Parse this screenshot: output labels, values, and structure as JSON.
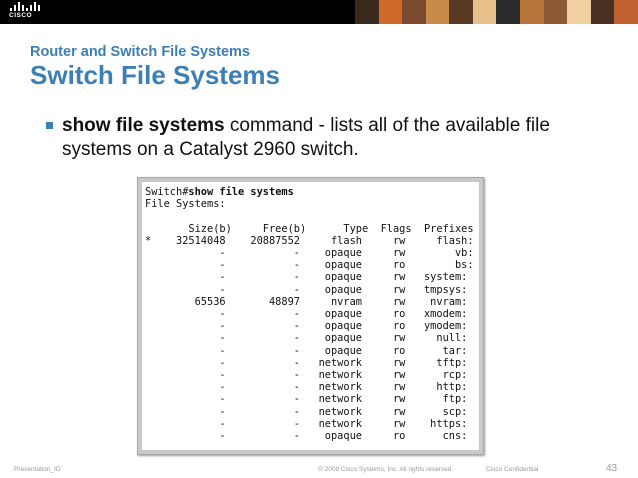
{
  "banner": {
    "logo_text": "CISCO",
    "photo_colors": [
      "#3a2a1c",
      "#d06a2a",
      "#7a4b2e",
      "#c98b4a",
      "#5a3a22",
      "#e8c08c",
      "#2a2a2a",
      "#b8763c",
      "#8c5a34",
      "#f0d0a0",
      "#4a3020",
      "#c06030"
    ]
  },
  "slide": {
    "subtitle": "Router and Switch File Systems",
    "title": "Switch File Systems",
    "bullet_bold": "show file systems",
    "bullet_rest": " command -  lists all of the available file systems on a Catalyst 2960 switch."
  },
  "terminal": {
    "prompt": "Switch#",
    "command": "show file systems",
    "output": "File Systems:\n\n       Size(b)     Free(b)      Type  Flags  Prefixes\n*    32514048    20887552     flash     rw     flash:\n            -           -    opaque     rw        vb:\n            -           -    opaque     ro        bs:\n            -           -    opaque     rw   system:\n            -           -    opaque     rw   tmpsys:\n        65536       48897     nvram     rw    nvram:\n            -           -    opaque     ro   xmodem:\n            -           -    opaque     ro   ymodem:\n            -           -    opaque     rw     null:\n            -           -    opaque     ro      tar:\n            -           -   network     rw     tftp:\n            -           -   network     rw      rcp:\n            -           -   network     rw     http:\n            -           -   network     rw      ftp:\n            -           -   network     rw      scp:\n            -           -   network     rw    https:\n            -           -    opaque     ro      cns:"
  },
  "footer": {
    "left": "Presentation_ID",
    "center": "© 2008 Cisco Systems, Inc. All rights reserved.",
    "confidential": "Cisco Confidential",
    "page_number": "43"
  }
}
